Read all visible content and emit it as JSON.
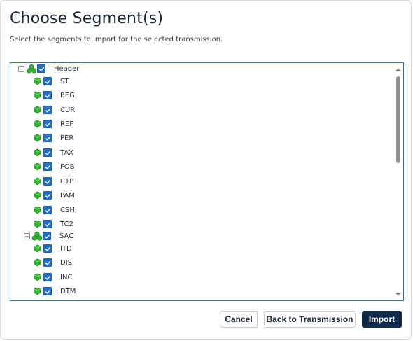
{
  "dialog": {
    "title": "Choose Segment(s)",
    "subtitle": "Select the segments to import for the selected transmission."
  },
  "tree": {
    "items": [
      {
        "label": "Header",
        "type": "group",
        "expander": "minus",
        "checked": true
      },
      {
        "label": "ST",
        "type": "segment",
        "checked": true
      },
      {
        "label": "BEG",
        "type": "segment",
        "checked": true
      },
      {
        "label": "CUR",
        "type": "segment",
        "checked": true
      },
      {
        "label": "REF",
        "type": "segment",
        "checked": true
      },
      {
        "label": "PER",
        "type": "segment",
        "checked": true
      },
      {
        "label": "TAX",
        "type": "segment",
        "checked": true
      },
      {
        "label": "FOB",
        "type": "segment",
        "checked": true
      },
      {
        "label": "CTP",
        "type": "segment",
        "checked": true
      },
      {
        "label": "PAM",
        "type": "segment",
        "checked": true
      },
      {
        "label": "CSH",
        "type": "segment",
        "checked": true
      },
      {
        "label": "TC2",
        "type": "segment",
        "checked": true
      },
      {
        "label": "SAC",
        "type": "group",
        "expander": "plus",
        "checked": true
      },
      {
        "label": "ITD",
        "type": "segment",
        "checked": true
      },
      {
        "label": "DIS",
        "type": "segment",
        "checked": true
      },
      {
        "label": "INC",
        "type": "segment",
        "checked": true
      },
      {
        "label": "DTM",
        "type": "segment",
        "checked": true
      }
    ]
  },
  "buttons": {
    "cancel": "Cancel",
    "back": "Back to Transmission",
    "import": "Import"
  },
  "colors": {
    "accent": "#1e6fd0",
    "primary_button": "#102a4c",
    "tree_border": "#2c6fb3",
    "segment_icon": "#2fb52f"
  }
}
